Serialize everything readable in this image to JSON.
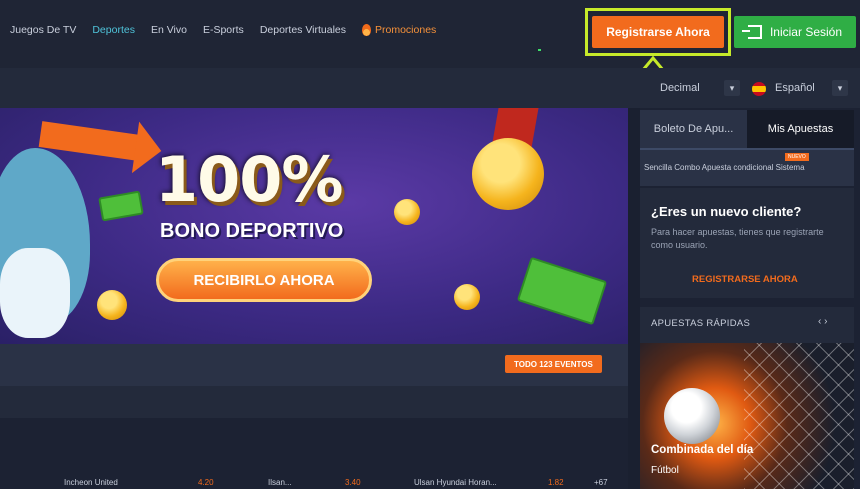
{
  "nav": {
    "items": [
      "Juegos De TV",
      "Deportes",
      "En Vivo",
      "E-Sports",
      "Deportes Virtuales"
    ],
    "promo_label": "Promociones",
    "active": "Deportes"
  },
  "header": {
    "register_label": "Registrarse Ahora",
    "login_label": "Iniciar Sesión"
  },
  "settings": {
    "odds_format": "Decimal",
    "language": "Español"
  },
  "banner": {
    "headline": "100%",
    "subheadline": "BONO DEPORTIVO",
    "cta": "RECIBIRLO AHORA"
  },
  "events": {
    "all_events_label": "TODO 123 EVENTOS"
  },
  "match_row": {
    "team1": "Incheon United",
    "odds1": "4.20",
    "team2": "Ilsan...",
    "odds2": "3.40",
    "team3": "Ulsan Hyundai Horan...",
    "odds3": "1.82",
    "more": "+67"
  },
  "betslip": {
    "tab_slip": "Boleto De Apu...",
    "tab_mybets": "Mis Apuestas",
    "types": "Sencilla  Combo  Apuesta condicional  Sistema",
    "new_tag": "NUEVO"
  },
  "new_customer": {
    "title": "¿Eres un nuevo cliente?",
    "text": "Para hacer apuestas, tienes que registrarte como usuario.",
    "link": "REGISTRARSE AHORA"
  },
  "quick_bets": {
    "title": "APUESTAS RÁPIDAS",
    "nav": "‹  ›",
    "card_title": "Combinada del día",
    "card_sport": "Fútbol"
  },
  "colors": {
    "accent_orange": "#f26b1d",
    "login_green": "#2fae45",
    "highlight_lime": "#c6ea2a",
    "active_nav": "#4fc3d9"
  }
}
